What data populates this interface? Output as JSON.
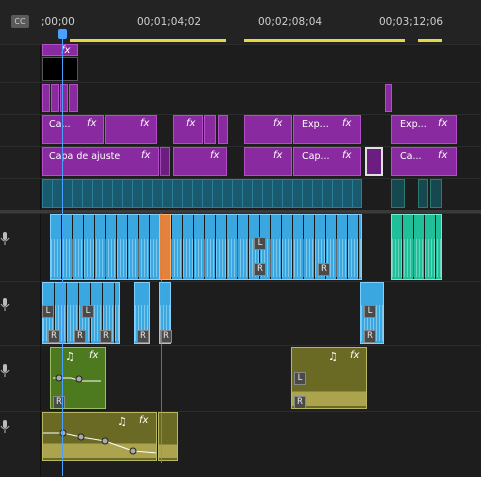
{
  "ruler": {
    "cc_label": "CC",
    "timecodes": [
      ";00;00",
      "00;01;04;02",
      "00;02;08;04",
      "00;03;12;06"
    ]
  },
  "video_clips": {
    "adjustment_label": "Capa de ajuste",
    "short_label_ca": "Ca...",
    "short_label_cap": "Cap...",
    "short_label_exp": "Exp...",
    "fx_label": "fx"
  },
  "audio": {
    "left_badge": "L",
    "right_badge": "R",
    "music_icon": "♫"
  },
  "colors": {
    "adjustment": "#8a2aa0",
    "video": "#1a5a6e",
    "audio": "#3aa7e0",
    "music": "#6a6a24",
    "playhead": "#4aa0ff",
    "work_area": "#e6d64a"
  }
}
